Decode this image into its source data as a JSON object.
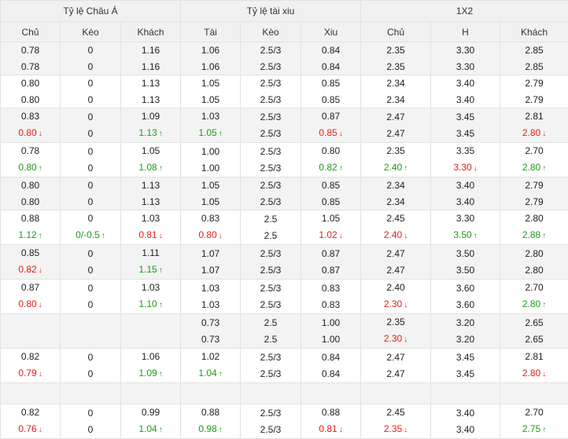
{
  "colors": {
    "up": "#1d9a1d",
    "down": "#e0201c",
    "header_bg": "#f1f1f1",
    "shade_bg": "#f3f3f3"
  },
  "arrows": {
    "up": "↑",
    "down": "↓"
  },
  "header": {
    "asian": "Tỷ lệ Châu Á",
    "overunder": "Tỷ lệ tài xiu",
    "x12": "1X2",
    "columns": [
      "Chủ",
      "Kèo",
      "Khách",
      "Tài",
      "Kèo",
      "Xiu",
      "Chủ",
      "H",
      "Khách"
    ]
  },
  "rows": [
    {
      "shade": true,
      "cells": [
        [
          {
            "v": "0.78"
          },
          {
            "v": "0.78"
          }
        ],
        [
          {
            "v": "0"
          },
          {
            "v": "0"
          }
        ],
        [
          {
            "v": "1.16"
          },
          {
            "v": "1.16"
          }
        ],
        [
          {
            "v": "1.06"
          },
          {
            "v": "1.06"
          }
        ],
        [
          {
            "v": "2.5/3"
          },
          {
            "v": "2.5/3"
          }
        ],
        [
          {
            "v": "0.84"
          },
          {
            "v": "0.84"
          }
        ],
        [
          {
            "v": "2.35"
          },
          {
            "v": "2.35"
          }
        ],
        [
          {
            "v": "3.30"
          },
          {
            "v": "3.30"
          }
        ],
        [
          {
            "v": "2.85"
          },
          {
            "v": "2.85"
          }
        ]
      ]
    },
    {
      "shade": false,
      "cells": [
        [
          {
            "v": "0.80"
          },
          {
            "v": "0.80"
          }
        ],
        [
          {
            "v": "0"
          },
          {
            "v": "0"
          }
        ],
        [
          {
            "v": "1.13"
          },
          {
            "v": "1.13"
          }
        ],
        [
          {
            "v": "1.05"
          },
          {
            "v": "1.05"
          }
        ],
        [
          {
            "v": "2.5/3"
          },
          {
            "v": "2.5/3"
          }
        ],
        [
          {
            "v": "0.85"
          },
          {
            "v": "0.85"
          }
        ],
        [
          {
            "v": "2.34"
          },
          {
            "v": "2.34"
          }
        ],
        [
          {
            "v": "3.40"
          },
          {
            "v": "3.40"
          }
        ],
        [
          {
            "v": "2.79"
          },
          {
            "v": "2.79"
          }
        ]
      ]
    },
    {
      "shade": true,
      "cells": [
        [
          {
            "v": "0.83"
          },
          {
            "v": "0.80",
            "t": "down"
          }
        ],
        [
          {
            "v": "0"
          },
          {
            "v": "0"
          }
        ],
        [
          {
            "v": "1.09"
          },
          {
            "v": "1.13",
            "t": "up"
          }
        ],
        [
          {
            "v": "1.03"
          },
          {
            "v": "1.05",
            "t": "up"
          }
        ],
        [
          {
            "v": "2.5/3"
          },
          {
            "v": "2.5/3"
          }
        ],
        [
          {
            "v": "0.87"
          },
          {
            "v": "0.85",
            "t": "down"
          }
        ],
        [
          {
            "v": "2.47"
          },
          {
            "v": "2.47"
          }
        ],
        [
          {
            "v": "3.45"
          },
          {
            "v": "3.45"
          }
        ],
        [
          {
            "v": "2.81"
          },
          {
            "v": "2.80",
            "t": "down"
          }
        ]
      ]
    },
    {
      "shade": false,
      "cells": [
        [
          {
            "v": "0.78"
          },
          {
            "v": "0.80",
            "t": "up"
          }
        ],
        [
          {
            "v": "0"
          },
          {
            "v": "0"
          }
        ],
        [
          {
            "v": "1.05"
          },
          {
            "v": "1.08",
            "t": "up"
          }
        ],
        [
          {
            "v": "1.00"
          },
          {
            "v": "1.00"
          }
        ],
        [
          {
            "v": "2.5/3"
          },
          {
            "v": "2.5/3"
          }
        ],
        [
          {
            "v": "0.80"
          },
          {
            "v": "0.82",
            "t": "up"
          }
        ],
        [
          {
            "v": "2.35"
          },
          {
            "v": "2.40",
            "t": "up"
          }
        ],
        [
          {
            "v": "3.35"
          },
          {
            "v": "3.30",
            "t": "down"
          }
        ],
        [
          {
            "v": "2.70"
          },
          {
            "v": "2.80",
            "t": "up"
          }
        ]
      ]
    },
    {
      "shade": true,
      "cells": [
        [
          {
            "v": "0.80"
          },
          {
            "v": "0.80"
          }
        ],
        [
          {
            "v": "0"
          },
          {
            "v": "0"
          }
        ],
        [
          {
            "v": "1.13"
          },
          {
            "v": "1.13"
          }
        ],
        [
          {
            "v": "1.05"
          },
          {
            "v": "1.05"
          }
        ],
        [
          {
            "v": "2.5/3"
          },
          {
            "v": "2.5/3"
          }
        ],
        [
          {
            "v": "0.85"
          },
          {
            "v": "0.85"
          }
        ],
        [
          {
            "v": "2.34"
          },
          {
            "v": "2.34"
          }
        ],
        [
          {
            "v": "3.40"
          },
          {
            "v": "3.40"
          }
        ],
        [
          {
            "v": "2.79"
          },
          {
            "v": "2.79"
          }
        ]
      ]
    },
    {
      "shade": false,
      "cells": [
        [
          {
            "v": "0.88"
          },
          {
            "v": "1.12",
            "t": "up"
          }
        ],
        [
          {
            "v": "0"
          },
          {
            "v": "0/-0.5",
            "t": "up"
          }
        ],
        [
          {
            "v": "1.03"
          },
          {
            "v": "0.81",
            "t": "down"
          }
        ],
        [
          {
            "v": "0.83"
          },
          {
            "v": "0.80",
            "t": "down"
          }
        ],
        [
          {
            "v": "2.5"
          },
          {
            "v": "2.5"
          }
        ],
        [
          {
            "v": "1.05"
          },
          {
            "v": "1.02",
            "t": "down"
          }
        ],
        [
          {
            "v": "2.45"
          },
          {
            "v": "2.40",
            "t": "down"
          }
        ],
        [
          {
            "v": "3.30"
          },
          {
            "v": "3.50",
            "t": "up"
          }
        ],
        [
          {
            "v": "2.80"
          },
          {
            "v": "2.88",
            "t": "up"
          }
        ]
      ]
    },
    {
      "shade": true,
      "cells": [
        [
          {
            "v": "0.85"
          },
          {
            "v": "0.82",
            "t": "down"
          }
        ],
        [
          {
            "v": "0"
          },
          {
            "v": "0"
          }
        ],
        [
          {
            "v": "1.11"
          },
          {
            "v": "1.15",
            "t": "up"
          }
        ],
        [
          {
            "v": "1.07"
          },
          {
            "v": "1.07"
          }
        ],
        [
          {
            "v": "2.5/3"
          },
          {
            "v": "2.5/3"
          }
        ],
        [
          {
            "v": "0.87"
          },
          {
            "v": "0.87"
          }
        ],
        [
          {
            "v": "2.47"
          },
          {
            "v": "2.47"
          }
        ],
        [
          {
            "v": "3.50"
          },
          {
            "v": "3.50"
          }
        ],
        [
          {
            "v": "2.80"
          },
          {
            "v": "2.80"
          }
        ]
      ]
    },
    {
      "shade": false,
      "cells": [
        [
          {
            "v": "0.87"
          },
          {
            "v": "0.80",
            "t": "down"
          }
        ],
        [
          {
            "v": "0"
          },
          {
            "v": "0"
          }
        ],
        [
          {
            "v": "1.03"
          },
          {
            "v": "1.10",
            "t": "up"
          }
        ],
        [
          {
            "v": "1.03"
          },
          {
            "v": "1.03"
          }
        ],
        [
          {
            "v": "2.5/3"
          },
          {
            "v": "2.5/3"
          }
        ],
        [
          {
            "v": "0.83"
          },
          {
            "v": "0.83"
          }
        ],
        [
          {
            "v": "2.40"
          },
          {
            "v": "2.30",
            "t": "down"
          }
        ],
        [
          {
            "v": "3.60"
          },
          {
            "v": "3.60"
          }
        ],
        [
          {
            "v": "2.70"
          },
          {
            "v": "2.80",
            "t": "up"
          }
        ]
      ]
    },
    {
      "shade": true,
      "cells": [
        [],
        [],
        [],
        [
          {
            "v": "0.73"
          },
          {
            "v": "0.73"
          }
        ],
        [
          {
            "v": "2.5"
          },
          {
            "v": "2.5"
          }
        ],
        [
          {
            "v": "1.00"
          },
          {
            "v": "1.00"
          }
        ],
        [
          {
            "v": "2.35"
          },
          {
            "v": "2.30",
            "t": "down"
          }
        ],
        [
          {
            "v": "3.20"
          },
          {
            "v": "3.20"
          }
        ],
        [
          {
            "v": "2.65"
          },
          {
            "v": "2.65"
          }
        ]
      ]
    },
    {
      "shade": false,
      "cells": [
        [
          {
            "v": "0.82"
          },
          {
            "v": "0.79",
            "t": "down"
          }
        ],
        [
          {
            "v": "0"
          },
          {
            "v": "0"
          }
        ],
        [
          {
            "v": "1.06"
          },
          {
            "v": "1.09",
            "t": "up"
          }
        ],
        [
          {
            "v": "1.02"
          },
          {
            "v": "1.04",
            "t": "up"
          }
        ],
        [
          {
            "v": "2.5/3"
          },
          {
            "v": "2.5/3"
          }
        ],
        [
          {
            "v": "0.84"
          },
          {
            "v": "0.84"
          }
        ],
        [
          {
            "v": "2.47"
          },
          {
            "v": "2.47"
          }
        ],
        [
          {
            "v": "3.45"
          },
          {
            "v": "3.45"
          }
        ],
        [
          {
            "v": "2.81"
          },
          {
            "v": "2.80",
            "t": "down"
          }
        ]
      ]
    },
    {
      "shade": true,
      "spacer": true,
      "cells": [
        [],
        [],
        [],
        [],
        [],
        [],
        [],
        [],
        []
      ]
    },
    {
      "shade": false,
      "last": true,
      "cells": [
        [
          {
            "v": "0.82"
          },
          {
            "v": "0.76",
            "t": "down"
          }
        ],
        [
          {
            "v": "0"
          },
          {
            "v": "0"
          }
        ],
        [
          {
            "v": "0.99"
          },
          {
            "v": "1.04",
            "t": "up"
          }
        ],
        [
          {
            "v": "0.88"
          },
          {
            "v": "0.98",
            "t": "up"
          }
        ],
        [
          {
            "v": "2.5/3"
          },
          {
            "v": "2.5/3"
          }
        ],
        [
          {
            "v": "0.88"
          },
          {
            "v": "0.81",
            "t": "down"
          }
        ],
        [
          {
            "v": "2.45"
          },
          {
            "v": "2.35",
            "t": "down"
          }
        ],
        [
          {
            "v": "3.40"
          },
          {
            "v": "3.40"
          }
        ],
        [
          {
            "v": "2.70"
          },
          {
            "v": "2.75",
            "t": "up"
          }
        ]
      ]
    }
  ]
}
